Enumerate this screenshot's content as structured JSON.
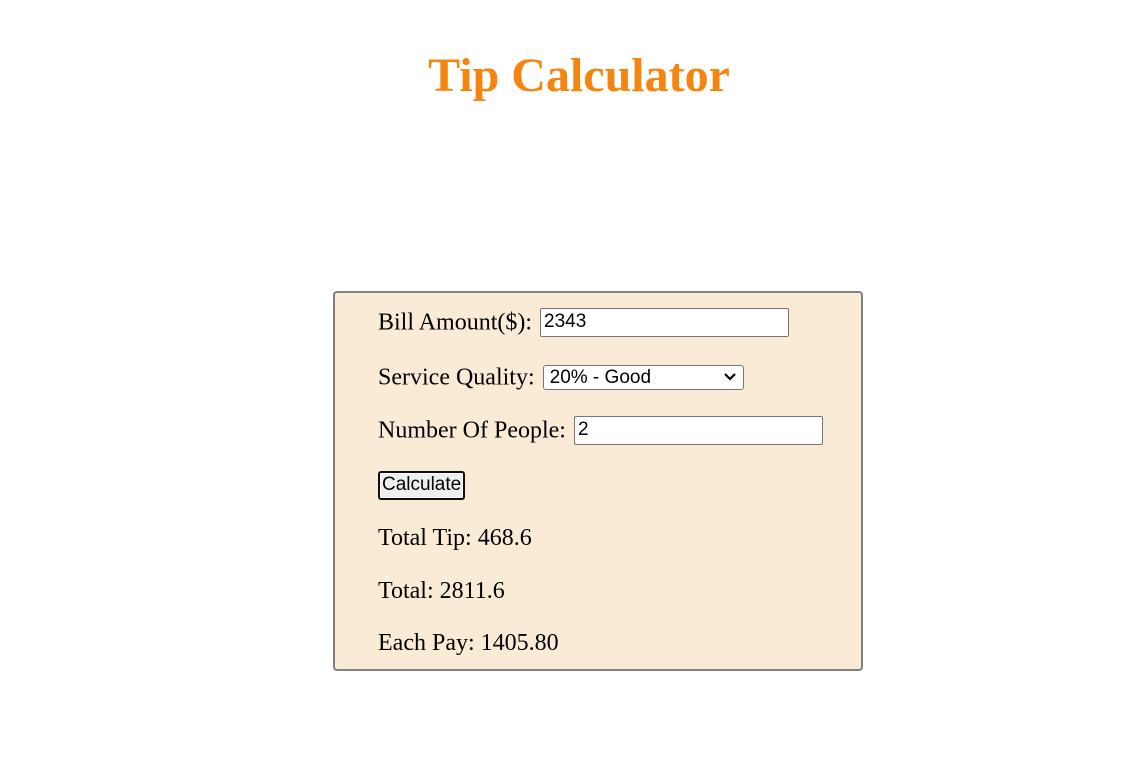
{
  "page": {
    "title": "Tip Calculator",
    "accent_color": "#f5850e",
    "card_background": "#faebd7"
  },
  "form": {
    "bill_label": "Bill Amount($):",
    "bill_value": "2343",
    "service_label": "Service Quality:",
    "service_selected": "20% - Good",
    "people_label": "Number Of People:",
    "people_value": "2",
    "calculate_label": "Calculate"
  },
  "results": {
    "total_tip": "Total Tip: 468.6",
    "total": "Total: 2811.6",
    "each_pay": "Each Pay: 1405.80"
  }
}
